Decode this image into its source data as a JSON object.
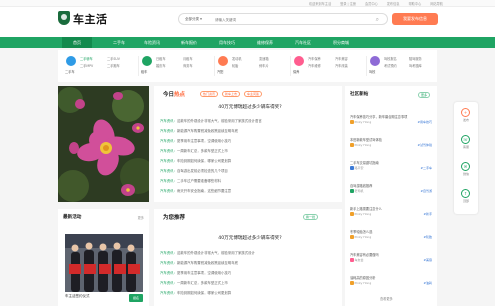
{
  "topbar": {
    "links": [
      "欢迎来到车主活",
      "登录 | 注册",
      "会员中心",
      "发布信息",
      "帮助中心",
      "网站导航"
    ]
  },
  "header": {
    "logo_text": "车主活",
    "search_category": "全部分类",
    "search_placeholder": "请输入关键词",
    "sell_button": "我要发布信息"
  },
  "nav": {
    "items": [
      "首页",
      "二手车",
      "车险资讯",
      "新车报价",
      "用车技巧",
      "维修保养",
      "汽车社区",
      "积分商城"
    ]
  },
  "categories": [
    {
      "name": "二手车",
      "links": [
        "二手轿车",
        "二手SUV",
        "二手MPV",
        "二手跑车"
      ],
      "color": "#2f9be6"
    },
    {
      "name": "租车",
      "links": [
        "日租车",
        "月租车",
        "婚庆车",
        "商务车"
      ],
      "color": "#1fa463"
    },
    {
      "name": "汽配",
      "links": [
        "发动机",
        "变速箱",
        "轮胎",
        "刹车片"
      ],
      "color": "#ff7b52"
    },
    {
      "name": "保养",
      "links": [
        "汽车保养",
        "汽车美容",
        "汽车维修",
        "汽车改装"
      ],
      "color": "#ff5d8f"
    },
    {
      "name": "驾校",
      "links": [
        "驾校报名",
        "陪驾服务",
        "考试预约",
        "驾考题库"
      ],
      "color": "#8e6bd6"
    }
  ],
  "today_hot": {
    "title_a": "今日",
    "title_b": "热点",
    "tags": [
      "热门资讯",
      "新车上市",
      "车主问答"
    ],
    "headline": "40万元博瑞超过多少辆车得奖?",
    "rows": [
      {
        "tag": "汽车资讯：",
        "text": "这款车的外观设计非常大气，前脸采用了家族式设计语言"
      },
      {
        "tag": "汽车资讯：",
        "text": "新能源汽车购置税减免政策延续至明年底"
      },
      {
        "tag": "汽车资讯：",
        "text": "夏季用车注意事项，空调使用小技巧"
      },
      {
        "tag": "汽车资讯：",
        "text": "一周新车汇总，多款车型正式上市"
      },
      {
        "tag": "汽车资讯：",
        "text": "车险到期如何续保，哪家公司更划算"
      },
      {
        "tag": "汽车资讯：",
        "text": "自驾游出发前必须检查的几个项目"
      },
      {
        "tag": "汽车资讯：",
        "text": "二手车过户需要准备哪些材料"
      },
      {
        "tag": "汽车资讯：",
        "text": "雨天开车安全指南，这些细节要注意"
      }
    ]
  },
  "recommend": {
    "title": "为您推荐",
    "more": "换一批",
    "headline": "40万元博瑞超过多少辆车得奖?",
    "rows": [
      {
        "tag": "汽车资讯：",
        "text": "这款车的外观设计非常大气，前脸采用了家族式设计"
      },
      {
        "tag": "汽车资讯：",
        "text": "新能源汽车购置税减免政策延续至明年底"
      },
      {
        "tag": "汽车资讯：",
        "text": "夏季用车注意事项，空调使用小技巧"
      },
      {
        "tag": "汽车资讯：",
        "text": "一周新车汇总，多款车型正式上市"
      },
      {
        "tag": "汽车资讯：",
        "text": "车险到期如何续保，哪家公司更划算"
      }
    ]
  },
  "community": {
    "title": "社区新帖",
    "more": "更多",
    "posts": [
      {
        "text": "汽车保养技巧分享，新车磨合期注意事项",
        "user": "Pinky Hong",
        "tag": "#用车技巧"
      },
      {
        "text": "本田新款车型试驾体验",
        "user": "Pinky Hong",
        "tag": "#试驾体验"
      },
      {
        "text": "二手车交易避坑指南",
        "user": "路平安",
        "tag": "#二手车"
      },
      {
        "text": "自驾游路线推荐",
        "user": "老司机",
        "tag": "#自驾游"
      },
      {
        "text": "新手上路需要注意什么",
        "user": "Pinky Hong",
        "tag": "#新手"
      },
      {
        "text": "冬季轮胎怎么选",
        "user": "Pinky Hong",
        "tag": "#轮胎"
      },
      {
        "text": "汽车美容有必要做吗",
        "user": "车友会",
        "tag": "#美容"
      },
      {
        "text": "油耗高的原因分析",
        "user": "Pinky Hong",
        "tag": "#油耗"
      }
    ],
    "footer": "查看更多"
  },
  "side_tools": [
    {
      "label": "发布",
      "glyph": "+"
    },
    {
      "label": "客服",
      "glyph": "☏"
    },
    {
      "label": "微信",
      "glyph": "✉"
    },
    {
      "label": "顶部",
      "glyph": "↑"
    }
  ],
  "activity": {
    "title": "最新活动",
    "more": "更多",
    "caption": "车主活签约仪式",
    "button": "报名"
  }
}
